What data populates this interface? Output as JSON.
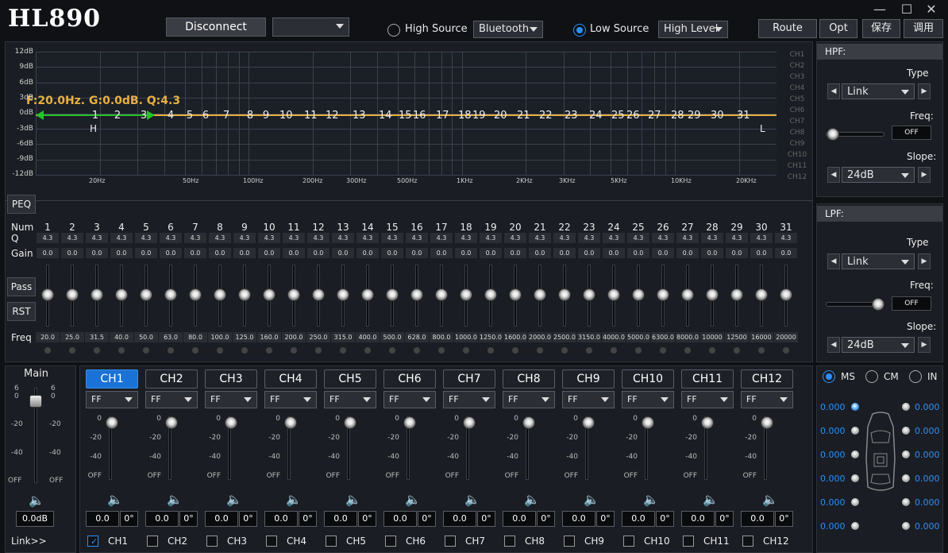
{
  "app": {
    "title": "HL890"
  },
  "toolbar": {
    "disconnect": "Disconnect",
    "device_select": "",
    "high_source": "High Source",
    "high_source_value": "Bluetooth",
    "low_source": "Low Source",
    "low_source_value": "High Level",
    "route": "Route",
    "opt": "Opt",
    "save": "保存",
    "recall": "调用"
  },
  "window": {
    "minimize": "—",
    "maximize": "☐",
    "close": "✕"
  },
  "graph": {
    "readout": "F:20.0Hz. G:0.0dB. Q:4.3",
    "y_labels": [
      "12dB",
      "9dB",
      "6dB",
      "3dB",
      "0dB",
      "-3dB",
      "-6dB",
      "-9dB",
      "-12dB"
    ],
    "x_labels": [
      "20Hz",
      "50Hz",
      "100Hz",
      "200Hz",
      "300Hz",
      "500Hz",
      "1KHz",
      "2KHz",
      "3KHz",
      "5KHz",
      "10KHz",
      "20KHz"
    ],
    "band_markers": [
      "1",
      "2",
      "3",
      "4",
      "5",
      "6",
      "7",
      "8",
      "9",
      "10",
      "11",
      "12",
      "13",
      "14",
      "15",
      "16",
      "17",
      "18",
      "19",
      "20",
      "21",
      "22",
      "23",
      "24",
      "25",
      "26",
      "27",
      "28",
      "29",
      "30",
      "31"
    ],
    "h_marker": "H",
    "l_marker": "L",
    "ch_list": [
      "CH1",
      "CH2",
      "CH3",
      "CH4",
      "CH5",
      "CH6",
      "CH7",
      "CH8",
      "CH9",
      "CH10",
      "CH11",
      "CH12"
    ],
    "line_color": "#e8b040",
    "accent_green": "#27c22a"
  },
  "peq": {
    "peq_label": "PEQ",
    "num_label": "Num",
    "q_label": "Q",
    "gain_label": "Gain",
    "pass_label": "Pass",
    "rst_label": "RST",
    "freq_label": "Freq",
    "bands": [
      {
        "n": "1",
        "q": "4.3",
        "gain": "0.0",
        "freq": "20.0"
      },
      {
        "n": "2",
        "q": "4.3",
        "gain": "0.0",
        "freq": "25.0"
      },
      {
        "n": "3",
        "q": "4.3",
        "gain": "0.0",
        "freq": "31.5"
      },
      {
        "n": "4",
        "q": "4.3",
        "gain": "0.0",
        "freq": "40.0"
      },
      {
        "n": "5",
        "q": "4.3",
        "gain": "0.0",
        "freq": "50.0"
      },
      {
        "n": "6",
        "q": "4.3",
        "gain": "0.0",
        "freq": "63.0"
      },
      {
        "n": "7",
        "q": "4.3",
        "gain": "0.0",
        "freq": "80.0"
      },
      {
        "n": "8",
        "q": "4.3",
        "gain": "0.0",
        "freq": "100.0"
      },
      {
        "n": "9",
        "q": "4.3",
        "gain": "0.0",
        "freq": "125.0"
      },
      {
        "n": "10",
        "q": "4.3",
        "gain": "0.0",
        "freq": "160.0"
      },
      {
        "n": "11",
        "q": "4.3",
        "gain": "0.0",
        "freq": "200.0"
      },
      {
        "n": "12",
        "q": "4.3",
        "gain": "0.0",
        "freq": "250.0"
      },
      {
        "n": "13",
        "q": "4.3",
        "gain": "0.0",
        "freq": "315.0"
      },
      {
        "n": "14",
        "q": "4.3",
        "gain": "0.0",
        "freq": "400.0"
      },
      {
        "n": "15",
        "q": "4.3",
        "gain": "0.0",
        "freq": "500.0"
      },
      {
        "n": "16",
        "q": "4.3",
        "gain": "0.0",
        "freq": "628.0"
      },
      {
        "n": "17",
        "q": "4.3",
        "gain": "0.0",
        "freq": "800.0"
      },
      {
        "n": "18",
        "q": "4.3",
        "gain": "0.0",
        "freq": "1000.0"
      },
      {
        "n": "19",
        "q": "4.3",
        "gain": "0.0",
        "freq": "1250.0"
      },
      {
        "n": "20",
        "q": "4.3",
        "gain": "0.0",
        "freq": "1600.0"
      },
      {
        "n": "21",
        "q": "4.3",
        "gain": "0.0",
        "freq": "2000.0"
      },
      {
        "n": "22",
        "q": "4.3",
        "gain": "0.0",
        "freq": "2500.0"
      },
      {
        "n": "23",
        "q": "4.3",
        "gain": "0.0",
        "freq": "3150.0"
      },
      {
        "n": "24",
        "q": "4.3",
        "gain": "0.0",
        "freq": "4000.0"
      },
      {
        "n": "25",
        "q": "4.3",
        "gain": "0.0",
        "freq": "5000.0"
      },
      {
        "n": "26",
        "q": "4.3",
        "gain": "0.0",
        "freq": "6300.0"
      },
      {
        "n": "27",
        "q": "4.3",
        "gain": "0.0",
        "freq": "8000.0"
      },
      {
        "n": "28",
        "q": "4.3",
        "gain": "0.0",
        "freq": "10000"
      },
      {
        "n": "29",
        "q": "4.3",
        "gain": "0.0",
        "freq": "12500"
      },
      {
        "n": "30",
        "q": "4.3",
        "gain": "0.0",
        "freq": "16000"
      },
      {
        "n": "31",
        "q": "4.3",
        "gain": "0.0",
        "freq": "20000"
      }
    ]
  },
  "hpf": {
    "title": "HPF:",
    "type_label": "Type",
    "type_value": "Link",
    "freq_label": "Freq:",
    "freq_value": "OFF",
    "slope_label": "Slope:",
    "slope_value": "24dB"
  },
  "lpf": {
    "title": "LPF:",
    "type_label": "Type",
    "type_value": "Link",
    "freq_label": "Freq:",
    "freq_value": "OFF",
    "slope_label": "Slope:",
    "slope_value": "24dB"
  },
  "main": {
    "label": "Main",
    "scale_left": [
      "6",
      "0",
      "-20",
      "-40",
      "OFF"
    ],
    "scale_right": [
      "6",
      "0",
      "-20",
      "-40",
      "OFF"
    ],
    "value": "0.0dB",
    "link": "Link>>"
  },
  "channels": [
    {
      "name": "CH1",
      "mode": "FF",
      "gain": "0.0",
      "phase": "0°",
      "check": "CH1",
      "active": true
    },
    {
      "name": "CH2",
      "mode": "FF",
      "gain": "0.0",
      "phase": "0°",
      "check": "CH2",
      "active": false
    },
    {
      "name": "CH3",
      "mode": "FF",
      "gain": "0.0",
      "phase": "0°",
      "check": "CH3",
      "active": false
    },
    {
      "name": "CH4",
      "mode": "FF",
      "gain": "0.0",
      "phase": "0°",
      "check": "CH4",
      "active": false
    },
    {
      "name": "CH5",
      "mode": "FF",
      "gain": "0.0",
      "phase": "0°",
      "check": "CH5",
      "active": false
    },
    {
      "name": "CH6",
      "mode": "FF",
      "gain": "0.0",
      "phase": "0°",
      "check": "CH6",
      "active": false
    },
    {
      "name": "CH7",
      "mode": "FF",
      "gain": "0.0",
      "phase": "0°",
      "check": "CH7",
      "active": false
    },
    {
      "name": "CH8",
      "mode": "FF",
      "gain": "0.0",
      "phase": "0°",
      "check": "CH8",
      "active": false
    },
    {
      "name": "CH9",
      "mode": "FF",
      "gain": "0.0",
      "phase": "0°",
      "check": "CH9",
      "active": false
    },
    {
      "name": "CH10",
      "mode": "FF",
      "gain": "0.0",
      "phase": "0°",
      "check": "CH10",
      "active": false
    },
    {
      "name": "CH11",
      "mode": "FF",
      "gain": "0.0",
      "phase": "0°",
      "check": "CH11",
      "active": false
    },
    {
      "name": "CH12",
      "mode": "FF",
      "gain": "0.0",
      "phase": "0°",
      "check": "CH12",
      "active": false
    }
  ],
  "ch_scale": [
    "0",
    "-20",
    "-20",
    "-40",
    "OFF"
  ],
  "delay": {
    "mode_ms": "MS",
    "mode_cm": "CM",
    "mode_in": "IN",
    "left_values": [
      "0.000",
      "0.000",
      "0.000",
      "0.000",
      "0.000",
      "0.000"
    ],
    "right_values": [
      "0.000",
      "0.000",
      "0.000",
      "0.000",
      "0.000",
      "0.000"
    ]
  }
}
